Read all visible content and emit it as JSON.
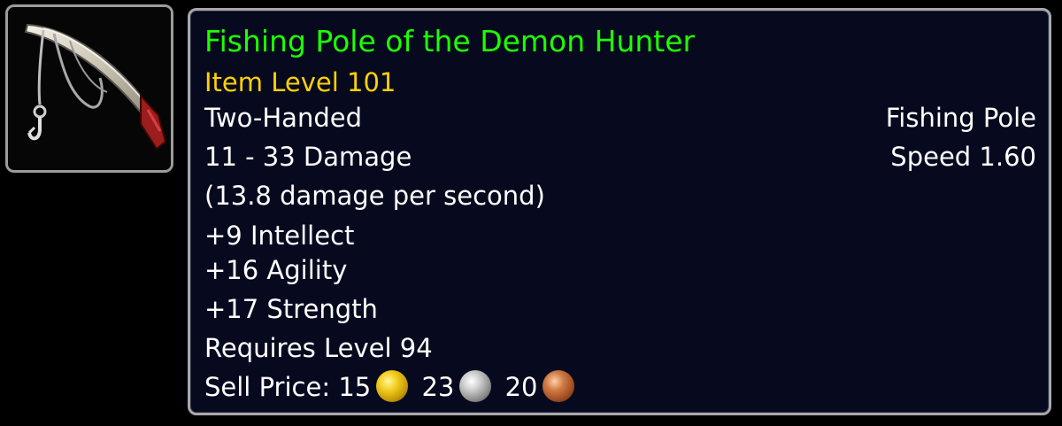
{
  "icon": {
    "name": "fishing-pole-icon"
  },
  "item": {
    "name": "Fishing Pole of the Demon Hunter",
    "name_color": "#1eff00",
    "item_level": "Item Level 101",
    "item_level_color": "#ffd100",
    "slot": "Two-Handed",
    "type": "Fishing Pole",
    "damage": "11 - 33 Damage",
    "speed": "Speed 1.60",
    "dps": "(13.8 damage per second)",
    "stats": [
      "+9 Intellect",
      "+16 Agility",
      "+17 Strength"
    ],
    "requires": "Requires Level 94",
    "sell_price": {
      "label": "Sell Price:",
      "gold": "15",
      "silver": "23",
      "copper": "20"
    }
  }
}
